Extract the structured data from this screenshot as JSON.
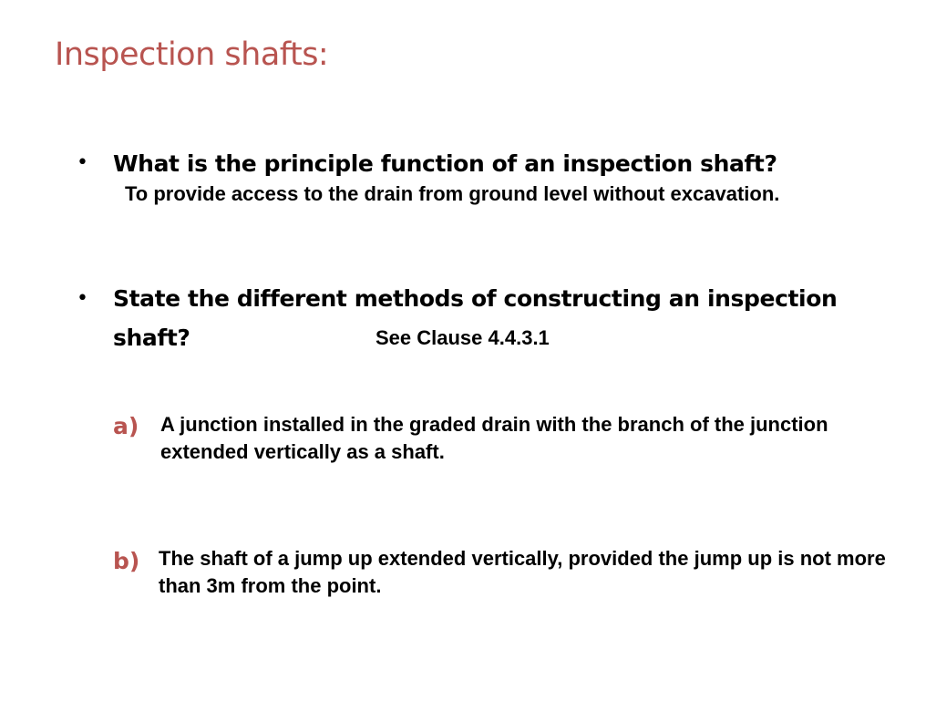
{
  "colors": {
    "accent": "#B85450",
    "text": "#000000",
    "background": "#FFFFFF"
  },
  "slide": {
    "title": "Inspection shafts:",
    "bullet_symbol": "•",
    "bullets": [
      {
        "question": "What is the principle function of an inspection shaft?",
        "answer": "To provide access to the drain from ground level without excavation."
      },
      {
        "question": "State the different methods of constructing an inspection shaft?",
        "reference": "See Clause 4.4.3.1"
      }
    ],
    "methods": [
      {
        "marker": "a)",
        "text": "A junction installed in the graded drain with the branch of the junction extended vertically as a shaft."
      },
      {
        "marker": "b)",
        "text": "The shaft of a jump up extended vertically, provided the jump up is not more than 3m from the point."
      }
    ]
  }
}
